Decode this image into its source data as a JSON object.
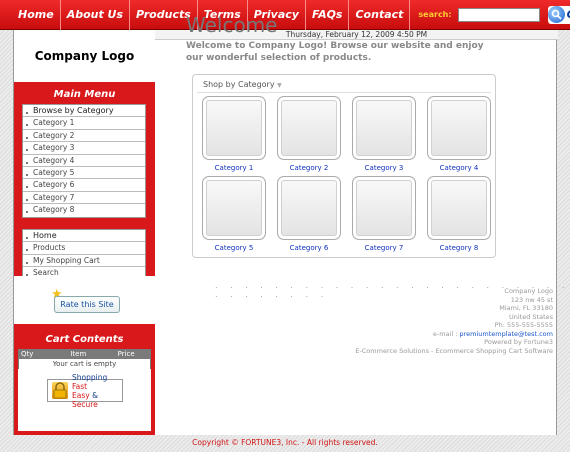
{
  "nav": {
    "items": [
      "Home",
      "About Us",
      "Products",
      "Terms",
      "Privacy",
      "FAQs",
      "Contact"
    ],
    "search_label": "search:",
    "search_value": "",
    "go_label": "Go"
  },
  "header": {
    "date": "Thursday, February 12, 2009 4:50 PM"
  },
  "sidebar": {
    "logo": "Company Logo",
    "main_menu_title": "Main Menu",
    "browse_title": "Browse by Category",
    "categories": [
      "Category 1",
      "Category 2",
      "Category 3",
      "Category 4",
      "Category 5",
      "Category 6",
      "Category 7",
      "Category 8"
    ],
    "links": [
      "Home",
      "Products",
      "My Shopping Cart",
      "Search"
    ],
    "rate_label": "Rate this Site",
    "cart_title": "Cart Contents",
    "cart_headers": [
      "Qty",
      "Item",
      "Price"
    ],
    "cart_empty": "Your cart is empty",
    "secure_line1": "Shopping",
    "secure_line1_red": "Fast",
    "secure_line2": "Easy",
    "secure_amp": " & ",
    "secure_line2_end": "Secure"
  },
  "main": {
    "title": "Welcome",
    "intro": "Welcome to  Company Logo! Browse our website and enjoy our wonderful selection of products.",
    "shop_title": "Shop by Category",
    "categories": [
      "Category 1",
      "Category 2",
      "Category 3",
      "Category 4",
      "Category 5",
      "Category 6",
      "Category 7",
      "Category 8"
    ],
    "dots": ". . . . . . . . . . . . . . . . . . . . . . . . . . . . . . . ."
  },
  "address": {
    "company": "Company Logo",
    "street": "123 nw 45 st",
    "city": "Miami, FL 33180",
    "country": "United States",
    "phone": "Ph: 555-555-5555",
    "email_label": "e-mail : ",
    "email": "premiumtemplate@test.com",
    "powered": "Powered by Fortune3",
    "solutions": "E-Commerce Solutions - Ecommerce Shopping Cart Software"
  },
  "footer": {
    "copyright": "Copyright © FORTUNE3, Inc. - All rights reserved."
  },
  "colors": {
    "brand_red": "#d8181b",
    "link_blue": "#1030c0",
    "search_label": "#ffcc33"
  }
}
